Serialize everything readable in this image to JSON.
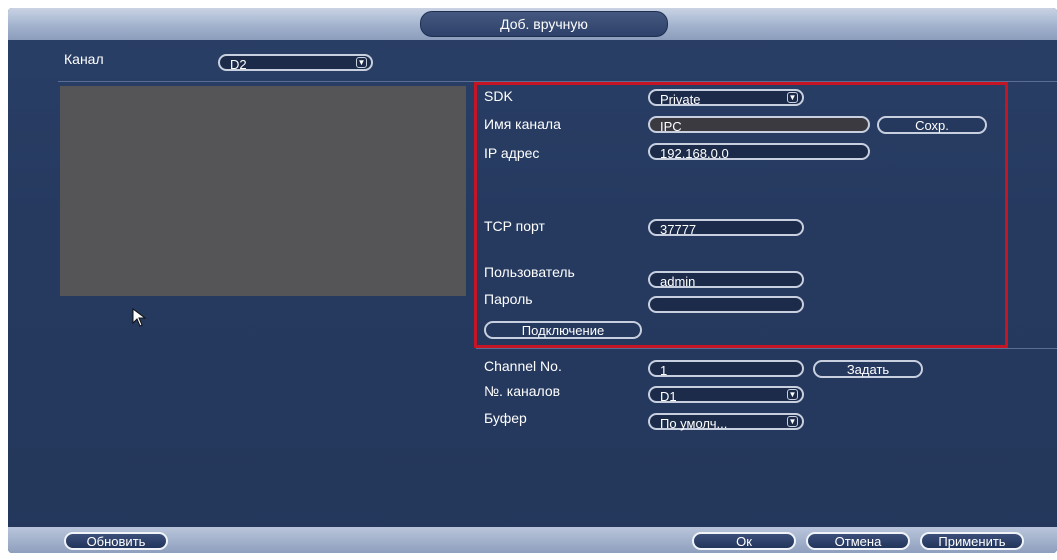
{
  "dialog": {
    "title": "Доб. вручную"
  },
  "channel": {
    "label": "Канал",
    "value": "D2"
  },
  "form": {
    "sdk_label": "SDK",
    "sdk_value": "Private",
    "channel_name_label": "Имя канала",
    "channel_name_value": "IPC",
    "save_label": "Сохр.",
    "ip_label": "IP адрес",
    "ip_value": "192.168.0.0",
    "tcp_label": "TCP порт",
    "tcp_value": "37777",
    "user_label": "Пользователь",
    "user_value": "admin",
    "password_label": "Пароль",
    "password_value": "",
    "connect_label": "Подключение",
    "channel_no_label": "Channel No.",
    "channel_no_value": "1",
    "set_label": "Задать",
    "channels_label": "№. каналов",
    "channels_value": "D1",
    "buffer_label": "Буфер",
    "buffer_value": "По умолч..."
  },
  "footer": {
    "refresh_label": "Обновить",
    "ok_label": "Ок",
    "cancel_label": "Отмена",
    "apply_label": "Применить"
  },
  "icons": {
    "dropdown": "chevron-down-icon",
    "cursor": "mouse-pointer-icon"
  },
  "colors": {
    "highlight": "#c51524",
    "panel": "#263a60"
  }
}
